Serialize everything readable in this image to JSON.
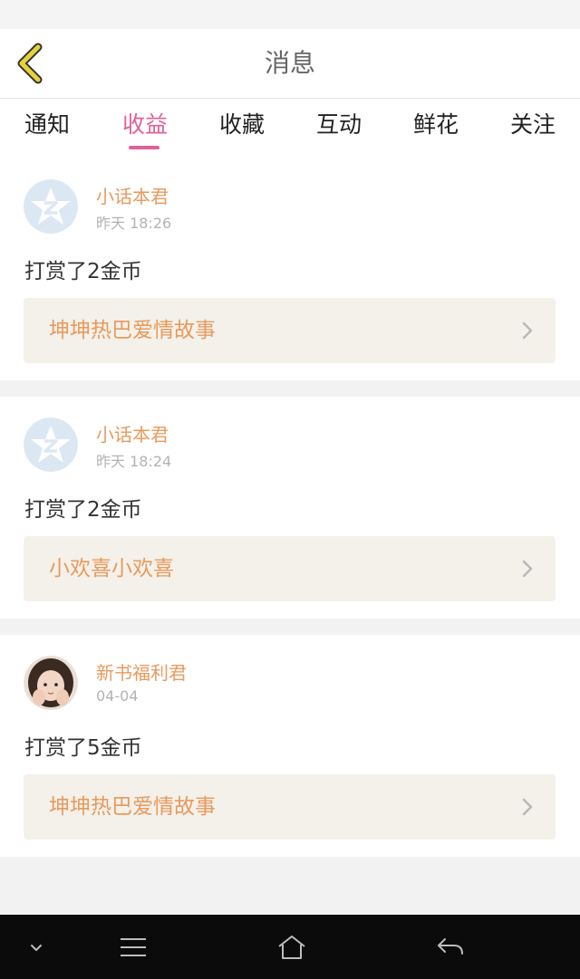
{
  "header": {
    "title": "消息",
    "back_icon": "chevron-left-icon",
    "back_color": "#e8d23a"
  },
  "tabs": [
    {
      "label": "通知",
      "active": false
    },
    {
      "label": "收益",
      "active": true
    },
    {
      "label": "收藏",
      "active": false
    },
    {
      "label": "互动",
      "active": false
    },
    {
      "label": "鲜花",
      "active": false
    },
    {
      "label": "关注",
      "active": false
    }
  ],
  "messages": [
    {
      "username": "小话本君",
      "time": "昨天 18:26",
      "action": "打赏了2金币",
      "book_title": "坤坤热巴爱情故事",
      "avatar": "qzone-star-avatar"
    },
    {
      "username": "小话本君",
      "time": "昨天 18:24",
      "action": "打赏了2金币",
      "book_title": "小欢喜小欢喜",
      "avatar": "qzone-star-avatar"
    },
    {
      "username": "新书福利君",
      "time": "04-04",
      "action": "打赏了5金币",
      "book_title": "坤坤热巴爱情故事",
      "avatar": "girl-photo-avatar"
    }
  ],
  "colors": {
    "accent": "#e0609a",
    "username": "#e89a5e",
    "book_link_bg": "#f3f1ea"
  },
  "system_nav": {
    "icons": [
      "chevron-down-icon",
      "menu-icon",
      "home-icon",
      "back-icon"
    ]
  }
}
